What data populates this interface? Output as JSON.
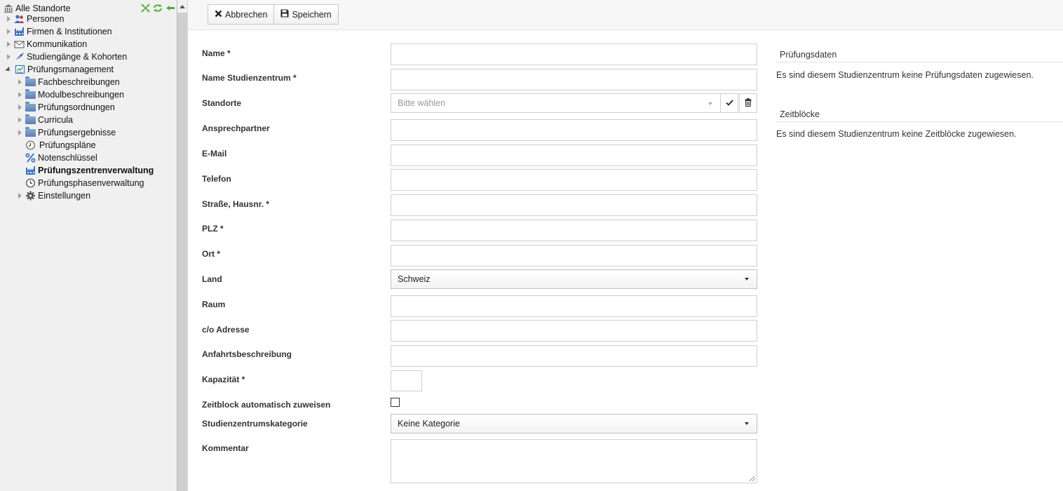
{
  "sidebar": {
    "root_label": "Alle Standorte",
    "tools": [
      "expand-all-icon",
      "refresh-icon",
      "collapse-sidebar-icon"
    ],
    "items": [
      {
        "label": "Personen",
        "icon": "persons-icon",
        "expander": "closed"
      },
      {
        "label": "Firmen & Institutionen",
        "icon": "factory-icon",
        "expander": "closed"
      },
      {
        "label": "Kommunikation",
        "icon": "envelope-icon",
        "expander": "closed"
      },
      {
        "label": "Studiengänge & Kohorten",
        "icon": "feather-icon",
        "expander": "closed"
      },
      {
        "label": "Prüfungsmanagement",
        "icon": "exam-icon",
        "expander": "open"
      },
      {
        "label": "Fachbeschreibungen",
        "icon": "folder-icon",
        "expander": "closed"
      },
      {
        "label": "Modulbeschreibungen",
        "icon": "folder-icon",
        "expander": "closed"
      },
      {
        "label": "Prüfungsordnungen",
        "icon": "folder-icon",
        "expander": "closed"
      },
      {
        "label": "Curricula",
        "icon": "folder-icon",
        "expander": "closed"
      },
      {
        "label": "Prüfungsergebnisse",
        "icon": "folder-icon",
        "expander": "closed"
      },
      {
        "label": "Prüfungspläne",
        "icon": "clock-icon",
        "expander": "none"
      },
      {
        "label": "Notenschlüssel",
        "icon": "percent-icon",
        "expander": "none"
      },
      {
        "label": "Prüfungszentrenverwaltung",
        "icon": "factory-icon",
        "expander": "none",
        "selected": true
      },
      {
        "label": "Prüfungsphasenverwaltung",
        "icon": "clock-icon",
        "expander": "none"
      },
      {
        "label": "Einstellungen",
        "icon": "gear-icon",
        "expander": "closed"
      }
    ]
  },
  "toolbar": {
    "cancel_label": "Abbrechen",
    "save_label": "Speichern"
  },
  "form": {
    "name_label": "Name *",
    "name_studienzentrum_label": "Name Studienzentrum *",
    "standorte_label": "Standorte",
    "standorte_placeholder": "Bitte wählen",
    "ansprechpartner_label": "Ansprechpartner",
    "email_label": "E-Mail",
    "telefon_label": "Telefon",
    "strasse_label": "Straße, Hausnr. *",
    "plz_label": "PLZ *",
    "ort_label": "Ort *",
    "land_label": "Land",
    "land_value": "Schweiz",
    "raum_label": "Raum",
    "co_adresse_label": "c/o Adresse",
    "anfahrt_label": "Anfahrtsbeschreibung",
    "kapazitaet_label": "Kapazität *",
    "zeitblock_auto_label": "Zeitblock automatisch zuweisen",
    "zeitblock_auto_checked": false,
    "kategorie_label": "Studienzentrumskategorie",
    "kategorie_value": "Keine Kategorie",
    "kommentar_label": "Kommentar"
  },
  "panels": {
    "pruefungsdaten_title": "Prüfungsdaten",
    "pruefungsdaten_text": "Es sind diesem Studienzentrum keine Prüfungsdaten zugewiesen.",
    "zeitbloecke_title": "Zeitblöcke",
    "zeitbloecke_text": "Es sind diesem Studienzentrum keine Zeitblöcke zugewiesen."
  }
}
